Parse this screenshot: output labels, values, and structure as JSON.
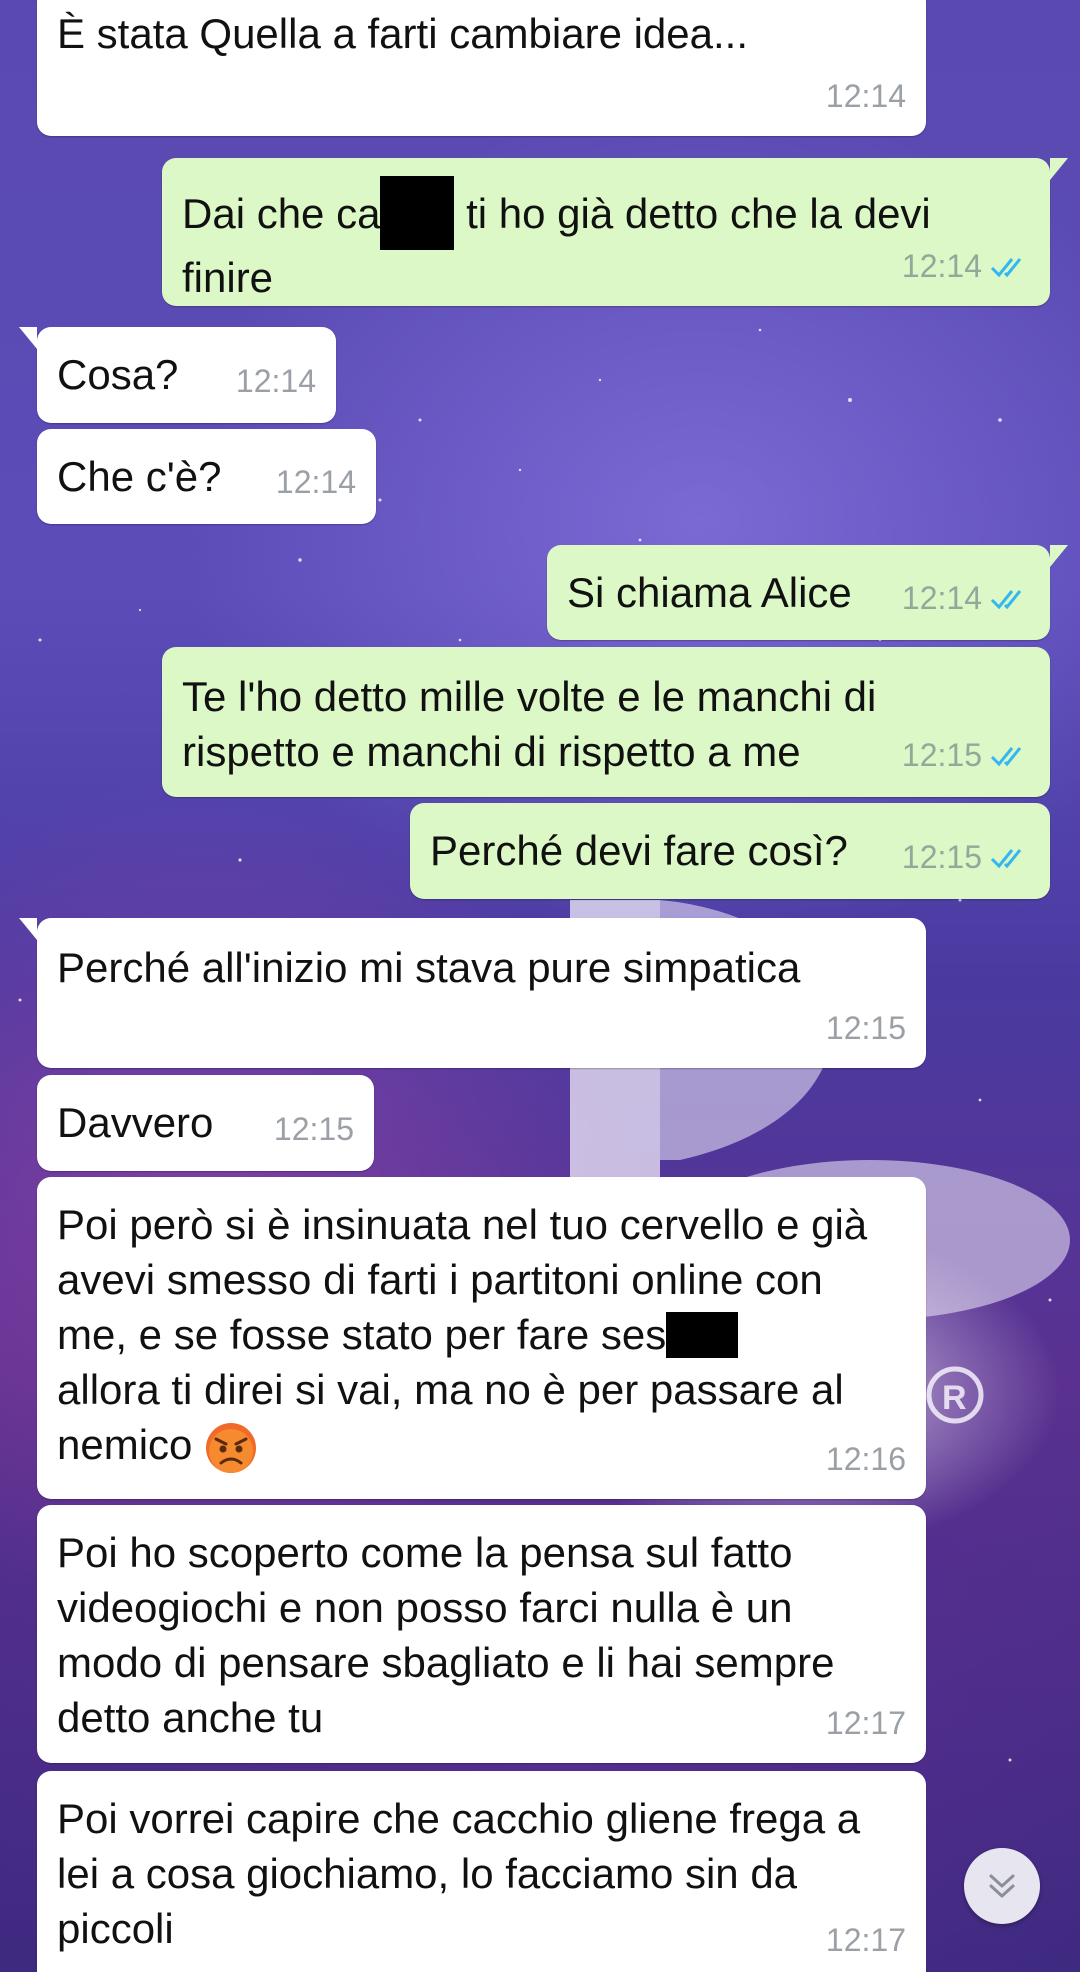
{
  "messages": [
    {
      "side": "in",
      "text": "È stata Quella a farti cambiare idea...",
      "time": "12:14"
    },
    {
      "side": "out",
      "text_before": "Dai che ca",
      "redacted": true,
      "text_after": " ti ho già detto che la devi finire",
      "time": "12:14",
      "read": true
    },
    {
      "side": "in",
      "text": "Cosa?",
      "time": "12:14"
    },
    {
      "side": "in",
      "text": "Che c'è?",
      "time": "12:14"
    },
    {
      "side": "out",
      "text": "Si chiama Alice",
      "time": "12:14",
      "read": true
    },
    {
      "side": "out",
      "text": "Te l'ho detto mille volte e le manchi di rispetto e manchi di rispetto a me",
      "time": "12:15",
      "read": true
    },
    {
      "side": "out",
      "text": "Perché devi fare così?",
      "time": "12:15",
      "read": true
    },
    {
      "side": "in",
      "text": "Perché all'inizio mi stava pure simpatica",
      "time": "12:15"
    },
    {
      "side": "in",
      "text": "Davvero",
      "time": "12:15"
    },
    {
      "side": "in",
      "text_before": "Poi però si è insinuata nel tuo cervello e già avevi smesso di farti i partitoni online con me, e se fosse stato per fare ses",
      "redacted": true,
      "text_after": "\nallora ti direi si vai, ma no è per passare al nemico ",
      "emoji": "angry-face",
      "time": "12:16"
    },
    {
      "side": "in",
      "text": "Poi ho scoperto come la pensa sul fatto videogiochi e non posso farci nulla è un modo di pensare sbagliato e li hai sempre detto anche tu",
      "time": "12:17"
    },
    {
      "side": "in",
      "text": "Poi vorrei capire che cacchio gliene frega a lei a cosa giochiamo, lo facciamo sin da piccoli",
      "time": "12:17"
    }
  ],
  "colors": {
    "incoming_bubble": "#ffffff",
    "outgoing_bubble": "#dcf8c6",
    "read_ticks": "#34b7f1",
    "timestamp": "#9aa0a6"
  },
  "icons": {
    "read_receipt": "double-check-icon",
    "scroll_down": "double-chevron-down-icon"
  }
}
